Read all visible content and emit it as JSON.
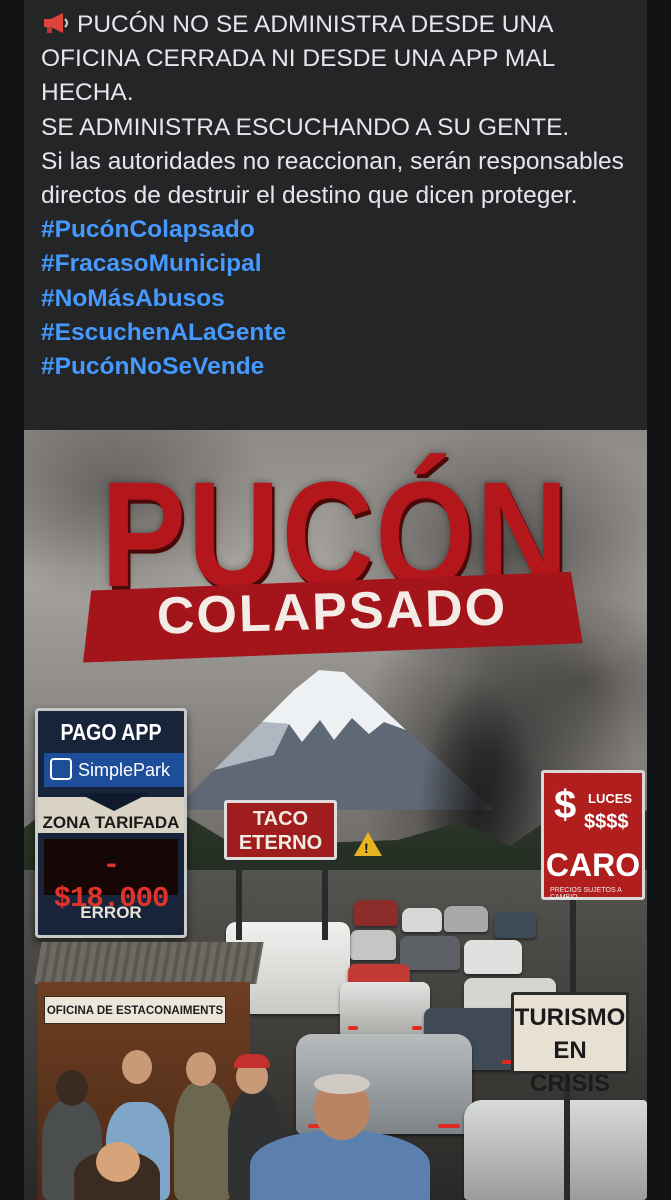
{
  "post": {
    "megaphone_icon": "megaphone-icon",
    "lines": [
      "PUCÓN NO SE ADMINISTRA DESDE UNA OFICINA CERRADA NI DESDE UNA APP MAL HECHA.",
      "SE ADMINISTRA ESCUCHANDO A SU GENTE.",
      "Si las autoridades no reaccionan, serán responsables directos de destruir el destino que dicen proteger."
    ],
    "hashtags": [
      "#PucónColapsado",
      "#FracasoMunicipal",
      "#NoMásAbusos",
      "#EscuchenALaGente",
      "#PucónNoSeVende"
    ]
  },
  "poster": {
    "title": "PUCÓN",
    "subtitle": "COLAPSADO",
    "sign_pago": {
      "title": "PAGO APP",
      "brand": "SimplePark",
      "zone": "ZONA TARIFADA",
      "amount": "- $18.000",
      "status": "ERROR"
    },
    "sign_taco": "TACO ETERNO",
    "warning_mark": "!",
    "sign_luces": {
      "symbol": "$",
      "top": "LUCES",
      "signs": "$$$$",
      "main": "CARO",
      "fine_print": "PRECIOS SUJETOS A CAMBIO"
    },
    "sign_turismo": "TURISMO EN CRISIS",
    "shop_sign": "OFICINA DE ESTACONAIMENTS"
  },
  "colors": {
    "background": "#121314",
    "card": "#242526",
    "text": "#e4e6eb",
    "hashtag": "#4599ff",
    "poster_red": "#b3161b"
  }
}
